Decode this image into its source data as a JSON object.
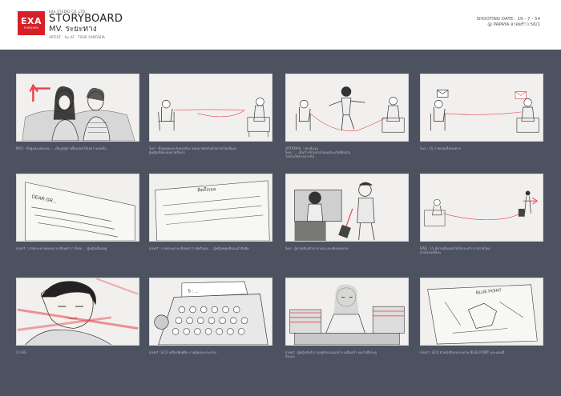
{
  "header": {
    "logo_mark": "EXA",
    "logo_sub": "FOREVER",
    "studio": "EXA STUDIO CO.,LTD.",
    "title": "STORYBOARD",
    "mv": "MV. ระยะทาง",
    "artist": "ARTIST : ป้ม AF · TRUE FANTASIA",
    "shooting_date": "SHOOTING DATE : 19 - 7 - 54",
    "location": "@ PAPAYA ลาดพร้าว 56/1"
  },
  "colors": {
    "board_bg": "#4c5260",
    "logo_red": "#d61f26",
    "accent_line": "#e8404a"
  },
  "panels": [
    {
      "caption": "MCU : ทั้งคู่มองแต่ละคน ... เห็นรูปผู้ชายยิ้มแสดงให้เธอว่าเธอเห็น"
    },
    {
      "caption": "Sue : ทั้งคู่อยู่คนละฝั่งของห้อง จดหมายต่อกันด้วยสายไหมสีแดง\nผู้หญิงเขียนจดหมายถึงเขา"
    },
    {
      "caption": "OPTIONAL : นักเต้นรุ่น\nSue : ... เดินก้าวข้ามสายไหมแต่ละเส้นที่ต่อกัน\nโดยไม่ให้ขาดจากกัน"
    },
    {
      "caption": "Sue : LS ภาพกลุ่มทั้งสองฝ่าย"
    },
    {
      "caption": "insert : ภาพกระดาษจดหมาย เขียนคำว่า Dear ... ผู้หญิงเขียนอยู่"
    },
    {
      "caption": "insert : ภาพกระดาษ เขียนคำว่า คิดถึงเธอ ... ผู้หญิงหยุดเขียนแล้วนิ่งคิด"
    },
    {
      "caption": "Sue : ผู้ชายเดินเข้ามาหาเธอ และพับจดหมาย"
    },
    {
      "caption": "EWS : LS ผู้ชายเดินออกไปกับกระเป๋า ลากสายไหม\nตัวเล็กลงเรื่อยๆ"
    },
    {
      "caption": "CU BG"
    },
    {
      "caption": "insert : ECU เครื่องพิมพ์ดีด ภาพปุ่มและกระดาษ"
    },
    {
      "caption": "insert : ผู้หญิงนั่งทำงานอยู่กับกองเอกสาร เหนื่อยล้า มองไปที่ประตู\nถึงแน่ๆ"
    },
    {
      "caption": "insert : ECU ตัวหนังสือบนกระดาษ BLUE POINT และแผนที่"
    }
  ],
  "panel_texts": {
    "letter_1": "DEAR GR...",
    "letter_2": "คิดถึงเธอ",
    "typewriter": "5 : ...",
    "map_label": "BLUE POINT"
  }
}
